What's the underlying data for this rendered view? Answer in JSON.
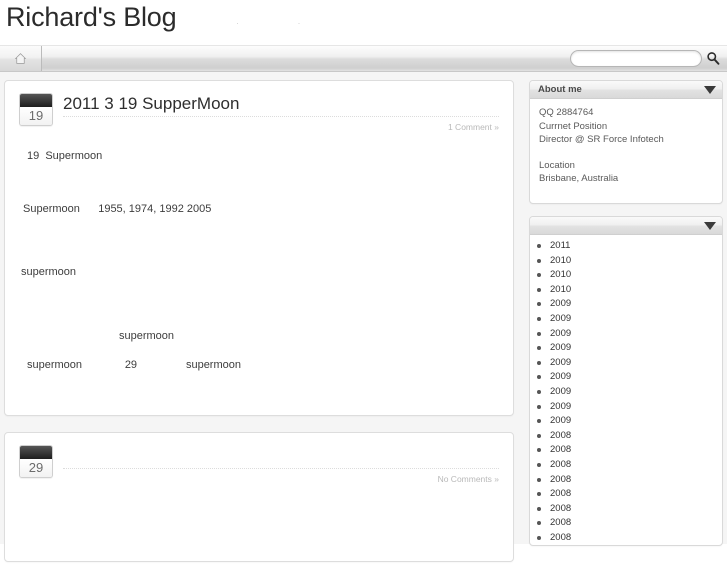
{
  "header": {
    "site_title": "Richard's Blog",
    "subtitle_marks": "·  ·",
    "home_icon": "home-icon",
    "search": {
      "value": "",
      "placeholder": "",
      "icon": "search-icon"
    }
  },
  "posts": [
    {
      "day": "19",
      "title": "2011 3 19 SupperMoon",
      "comments": "1 Comment »",
      "body_lines": [
        "19  Supermoon",
        "Supermoon      1955, 1974, 1992 2005",
        "supermoon",
        "supermoon",
        "supermoon              29                supermoon"
      ]
    },
    {
      "day": "29",
      "title": "",
      "comments": "No Comments »",
      "body_lines": []
    }
  ],
  "sidebar": {
    "widgets": [
      {
        "title": "About me",
        "collapse_icon": "chevron-down-icon",
        "lines": [
          "QQ 2884764",
          "Currnet Position",
          "Director @ SR Force Infotech",
          "",
          "Location",
          "Brisbane, Australia"
        ]
      },
      {
        "title": "",
        "collapse_icon": "chevron-down-icon",
        "items": [
          "2011",
          "2010",
          "2010",
          "2010",
          "2009",
          "2009",
          "2009",
          "2009",
          "2009",
          "2009",
          "2009",
          "2009",
          "2009",
          "2008",
          "2008",
          "2008",
          "2008",
          "2008",
          "2008",
          "2008",
          "2008"
        ]
      }
    ]
  },
  "colors": {
    "page_bg": "#f5f5f5",
    "panel_bg": "#ffffff",
    "border": "#dddddd",
    "muted_text": "#b9b9b9"
  }
}
